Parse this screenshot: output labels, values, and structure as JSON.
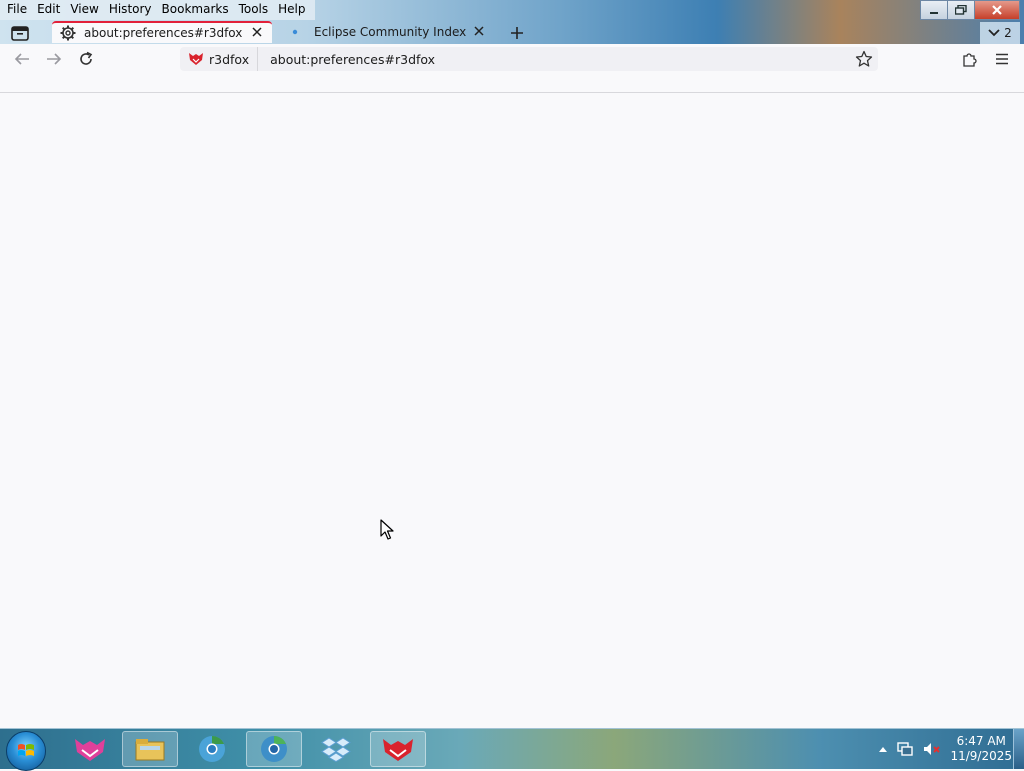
{
  "menu": {
    "file": "File",
    "edit": "Edit",
    "view": "View",
    "history": "History",
    "bookmarks": "Bookmarks",
    "tools": "Tools",
    "help": "Help"
  },
  "tabs": [
    {
      "title": "about:preferences#r3dfox",
      "icon": "gear-icon",
      "active": true
    },
    {
      "title": "Eclipse Community Index",
      "icon": "dot-icon",
      "active": false
    }
  ],
  "list_all_tabs_count": "2",
  "urlbar": {
    "identity_label": "r3dfox",
    "url": "about:preferences#r3dfox"
  },
  "taskbar": {
    "apps": [
      "r3dfox-pink-icon",
      "file-explorer-icon",
      "chromium-icon",
      "chromium-alt-icon",
      "dropbox-icon",
      "r3dfox-red-icon"
    ],
    "time": "6:47 AM",
    "date": "11/9/2025"
  },
  "colors": {
    "accent": "#e2203a",
    "background": "#f9f9fb",
    "urlbar_bg": "#f0f0f4"
  }
}
